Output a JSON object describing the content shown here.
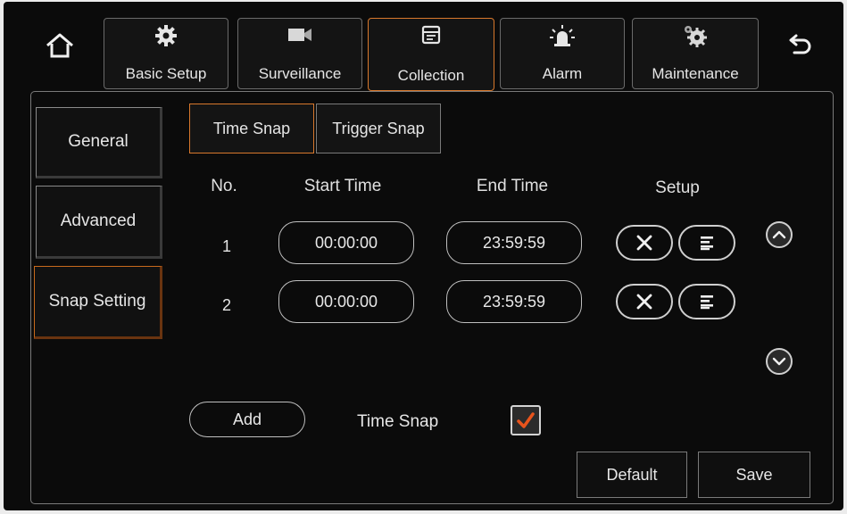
{
  "top_nav": {
    "home_icon": "home-icon",
    "back_icon": "back-arrow-icon",
    "tabs": [
      {
        "label": "Basic Setup",
        "icon": "gear-icon"
      },
      {
        "label": "Surveillance",
        "icon": "video-camera-icon"
      },
      {
        "label": "Collection",
        "icon": "collection-icon"
      },
      {
        "label": "Alarm",
        "icon": "alarm-light-icon"
      },
      {
        "label": "Maintenance",
        "icon": "maintenance-gears-icon"
      }
    ],
    "active_tab": "Collection"
  },
  "sidebar": {
    "items": [
      {
        "label": "General"
      },
      {
        "label": "Advanced"
      },
      {
        "label": "Snap Setting"
      }
    ],
    "active_item": "Snap Setting"
  },
  "sub_tabs": {
    "items": [
      {
        "label": "Time Snap"
      },
      {
        "label": "Trigger Snap"
      }
    ],
    "active": "Time Snap"
  },
  "table": {
    "headers": {
      "no": "No.",
      "start": "Start Time",
      "end": "End Time",
      "setup": "Setup"
    },
    "rows": [
      {
        "no": "1",
        "start": "00:00:00",
        "end": "23:59:59"
      },
      {
        "no": "2",
        "start": "00:00:00",
        "end": "23:59:59"
      }
    ]
  },
  "footer": {
    "add_label": "Add",
    "time_snap_label": "Time Snap",
    "time_snap_checked": true,
    "default_label": "Default",
    "save_label": "Save"
  },
  "colors": {
    "accent": "#d8782c",
    "background": "#0b0b0b",
    "check": "#e8541c"
  }
}
